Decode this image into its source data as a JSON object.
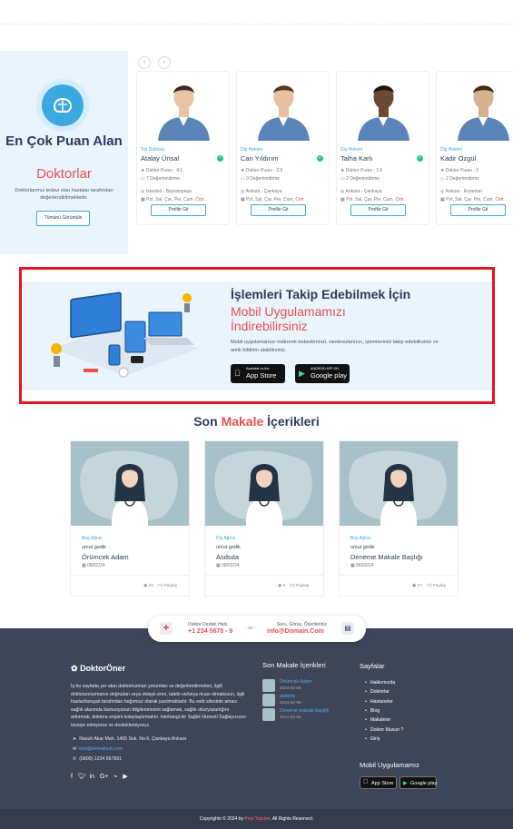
{
  "top_doctors": {
    "title": "En Çok Puan Alan",
    "title_highlight": "Doktorlar",
    "description": "Doktorlarımız tedavi olan hastalar tarafından değerlendirilmektedir.",
    "view_all_button": "Tümünü Görüntüle",
    "prev_arrow": "‹",
    "next_arrow": "›",
    "doctors": [
      {
        "specialty": "Tıp Doktoru",
        "name": "Atalay Ünsal",
        "rating": "Doktor Puanı : 4.1",
        "reviews": "7 Değerlendirme",
        "location": "İstanbul - Bayrampaşa",
        "days": "Pzt, Sal, Çar, Per, Cum,",
        "days_highlight": "Cmt",
        "button": "Profile Git"
      },
      {
        "specialty": "Diş Hekimi",
        "name": "Can Yıldırım",
        "rating": "Doktor Puanı : 2.9",
        "reviews": "0 Değerlendirme",
        "location": "Ankara - Çankaya",
        "days": "Pzt, Sal, Çar, Per, Cum,",
        "days_highlight": "Cmt",
        "button": "Profile Git"
      },
      {
        "specialty": "Diş Hekimi",
        "name": "Talha Karlı",
        "rating": "Doktor Puanı : 2.6",
        "reviews": "2 Değerlendirme",
        "location": "Ankara - Çankaya",
        "days": "Pzt, Sal, Çar, Per, Cum,",
        "days_highlight": "Cmt",
        "button": "Profile Git"
      },
      {
        "specialty": "Diş Hekimi",
        "name": "Kadir Özgül",
        "rating": "Doktor Puanı : 0",
        "reviews": "2 Değerlendirme",
        "location": "Ankara - Eryaman",
        "days": "Pzt, Sal, Çar, Per, Cum,",
        "days_highlight": "Cmt",
        "button": "Profile Git"
      }
    ]
  },
  "mobile_app": {
    "title": "İşlemleri Takip Edebilmek İçin",
    "subtitle": "Mobil Uygulamamızı İndirebilirsiniz",
    "description": "Mobil uygulamamızı indirerek tedavilerinizi, randevularınızı, işlemlerinizi takip edebilirsiniz ve anlık bildirim alabilirsiniz.",
    "app_store_small": "Available on the",
    "app_store": "App Store",
    "google_small": "ANDROID APP ON",
    "google": "Google play"
  },
  "articles": {
    "title_pre": "Son",
    "title_highlight": "Makale",
    "title_post": "İçerikleri",
    "items": [
      {
        "category": "Boş Ağrısı",
        "author": "umut gedik",
        "title": "Örümcek Adam",
        "date": "08/02/24",
        "views": "26",
        "share": "Paylaş"
      },
      {
        "category": "Diş Ağrısı",
        "author": "umut gedik",
        "title": "Asdsda",
        "date": "08/02/24",
        "views": "5",
        "share": "Paylaş"
      },
      {
        "category": "Boş Ağrısı",
        "author": "umut gedik",
        "title": "Deneme Makale Başlığı",
        "date": "06/02/24",
        "views": "27",
        "share": "Paylaş"
      }
    ]
  },
  "support": {
    "hotline_label": "Doktor Destek Hattı",
    "phone": "+1 234 5678 - 9",
    "or": "- ve -",
    "email_label": "Soru, Görüş, Önerileriniz",
    "email": "info@Domain.Com"
  },
  "footer": {
    "logo": "DoktorÖner",
    "about": "İş bu sayfada yer alan doktor/uzman yorumları ve değerlendirmeleri, ilgili doktorun/uzmanın doğrudan veya dolaylı emri, talebi ve/veya ricası olmaksızın, ilgili hasta/danışan tarafından bağımsız olarak yazılmaktadır. Bu web sitesinin amacı sağlık alanında kamuoyunun bilgilenmesini sağlamak, sağlık okuryazarlığını arttırmak, doktora erişimi kolaylaştırmaktır. Herhangi bir Sağlık Hizmeti Sağlayıcısını tavsiye etmiyoruz ve desteklemiyoruz.",
    "address": "Nasuh Akar Mah. 1405 Sok. No:6, Çankaya Ankara",
    "email": "info@domainurl.com",
    "phone": "(0800) 1234 567891",
    "recent_heading": "Son Makale İçerikleri",
    "recent": [
      {
        "title": "Örümcek Adam",
        "date": "2024-02-08"
      },
      {
        "title": "asdsda",
        "date": "2024-02-08"
      },
      {
        "title": "Deneme makale başlığı",
        "date": "2024-02-06"
      }
    ],
    "pages_heading": "Sayfalar",
    "pages": [
      "Hakkımızda",
      "Doktorlar",
      "Hastaneler",
      "Blog",
      "Makaleler",
      "Doktor Musun ?",
      "Giriş"
    ],
    "mobile_heading": "Mobil Uygulamamız",
    "app_store": "App Store",
    "google": "Google play",
    "copyright_pre": "Copyrights © 2024 by",
    "copyright_brand": "Proz Yazılım",
    "copyright_post": ". All Rights Reserved.",
    "social": [
      "f",
      "t",
      "in",
      "G+",
      "rss",
      "yt"
    ]
  },
  "colors": {
    "accent": "#3ba8e0",
    "highlight": "#e85050",
    "navy": "#2d3a5a",
    "footer": "#3f4559"
  }
}
